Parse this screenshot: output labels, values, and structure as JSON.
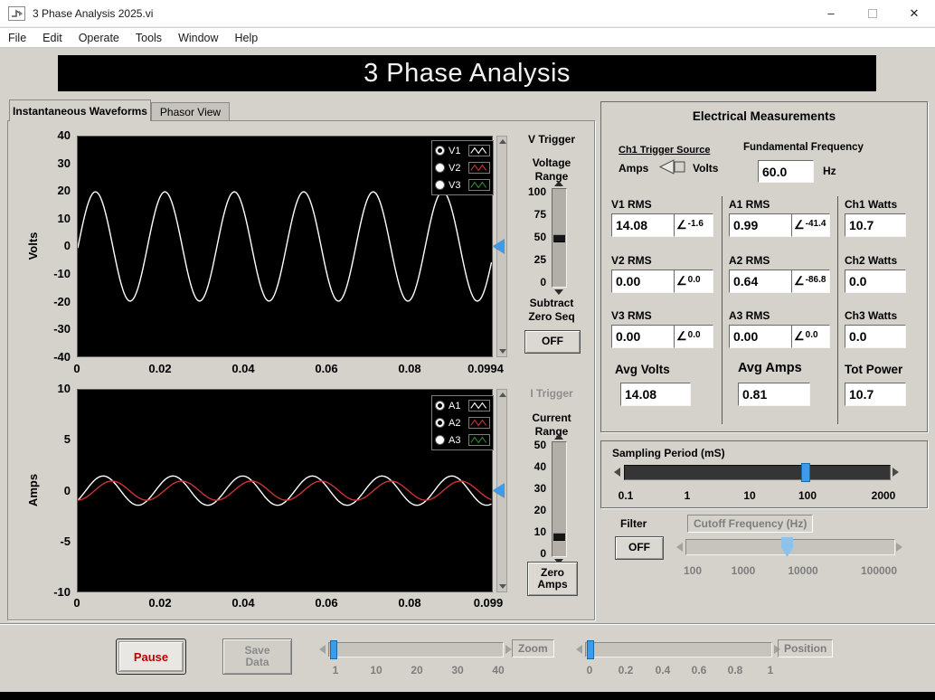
{
  "window": {
    "title": "3 Phase Analysis 2025.vi",
    "minimize": "–",
    "close": "✕"
  },
  "menu": {
    "items": [
      "File",
      "Edit",
      "Operate",
      "Tools",
      "Window",
      "Help"
    ]
  },
  "banner": {
    "title": "3 Phase Analysis"
  },
  "tabs": {
    "instantaneous": "Instantaneous Waveforms",
    "phasor": "Phasor View"
  },
  "volts_graph": {
    "ylabel": "Volts",
    "yticks": [
      "40",
      "30",
      "20",
      "10",
      "0",
      "-10",
      "-20",
      "-30",
      "-40"
    ],
    "xticks": [
      "0",
      "0.02",
      "0.04",
      "0.06",
      "0.08",
      "0.0994"
    ],
    "legend": [
      {
        "label": "V1",
        "selected": true,
        "color": "#ffffff"
      },
      {
        "label": "V2",
        "selected": false,
        "color": "#c83434"
      },
      {
        "label": "V3",
        "selected": false,
        "color": "#2e8b2e"
      }
    ],
    "chart_data": {
      "type": "line",
      "x_range": [
        0,
        0.0994
      ],
      "y_range": [
        -40,
        40
      ],
      "series": [
        {
          "name": "V1",
          "color": "#ffffff",
          "amplitude": 19.9,
          "frequency_hz": 60,
          "phase_deg": -1.6
        }
      ]
    }
  },
  "v_trigger": {
    "title": "V Trigger",
    "range_label_1": "Voltage",
    "range_label_2": "Range",
    "ticks": [
      "100",
      "75",
      "50",
      "25",
      "0"
    ],
    "value": 50,
    "subtract_label_1": "Subtract",
    "subtract_label_2": "Zero Seq",
    "subtract_button": "OFF"
  },
  "amps_graph": {
    "ylabel": "Amps",
    "yticks": [
      "10",
      "5",
      "0",
      "-5",
      "-10"
    ],
    "xticks": [
      "0",
      "0.02",
      "0.04",
      "0.06",
      "0.08",
      "0.099"
    ],
    "legend": [
      {
        "label": "A1",
        "selected": true,
        "color": "#ffffff"
      },
      {
        "label": "A2",
        "selected": true,
        "color": "#c83434"
      },
      {
        "label": "A3",
        "selected": false,
        "color": "#2e8b2e"
      }
    ],
    "chart_data": {
      "type": "line",
      "x_range": [
        0,
        0.099
      ],
      "y_range": [
        -10,
        10
      ],
      "series": [
        {
          "name": "A1",
          "color": "#ffffff",
          "amplitude": 1.45,
          "frequency_hz": 60,
          "phase_deg": -41.4
        },
        {
          "name": "A2",
          "color": "#c83434",
          "amplitude": 0.95,
          "frequency_hz": 60,
          "phase_deg": -86.8
        }
      ]
    }
  },
  "i_trigger": {
    "title": "I Trigger",
    "range_label_1": "Current",
    "range_label_2": "Range",
    "ticks": [
      "50",
      "40",
      "30",
      "20",
      "10",
      "0"
    ],
    "zero_button_1": "Zero",
    "zero_button_2": "Amps"
  },
  "measurements": {
    "title": "Electrical Measurements",
    "trigger_source": {
      "label": "Ch1 Trigger Source",
      "left": "Amps",
      "right": "Volts"
    },
    "fundamental": {
      "label": "Fundamental Frequency",
      "value": "60.0",
      "unit": "Hz"
    },
    "angle_symbol": "∠",
    "v1": {
      "label": "V1 RMS",
      "value": "14.08",
      "angle": "-1.6"
    },
    "v2": {
      "label": "V2 RMS",
      "value": "0.00",
      "angle": "0.0"
    },
    "v3": {
      "label": "V3 RMS",
      "value": "0.00",
      "angle": "0.0"
    },
    "a1": {
      "label": "A1 RMS",
      "value": "0.99",
      "angle": "-41.4"
    },
    "a2": {
      "label": "A2 RMS",
      "value": "0.64",
      "angle": "-86.8"
    },
    "a3": {
      "label": "A3 RMS",
      "value": "0.00",
      "angle": "0.0"
    },
    "w1": {
      "label": "Ch1 Watts",
      "value": "10.7"
    },
    "w2": {
      "label": "Ch2 Watts",
      "value": "0.0"
    },
    "w3": {
      "label": "Ch3 Watts",
      "value": "0.0"
    },
    "avg_volts": {
      "label": "Avg Volts",
      "value": "14.08"
    },
    "avg_amps": {
      "label": "Avg Amps",
      "value": "0.81"
    },
    "tot_power": {
      "label": "Tot Power",
      "value": "10.7"
    }
  },
  "sampling": {
    "label": "Sampling Period (mS)",
    "value": "100",
    "ticks": [
      "0.1",
      "1",
      "10",
      "100",
      "2000"
    ]
  },
  "filter": {
    "label": "Filter",
    "button": "OFF",
    "cutoff_label": "Cutoff Frequency (Hz)",
    "cutoff_ticks": [
      "100",
      "1000",
      "10000",
      "100000"
    ]
  },
  "footer": {
    "pause": "Pause",
    "save_1": "Save",
    "save_2": "Data",
    "zoom_label": "Zoom",
    "zoom_ticks": [
      "1",
      "10",
      "20",
      "30",
      "40"
    ],
    "position_label": "Position",
    "position_ticks": [
      "0",
      "0.2",
      "0.4",
      "0.6",
      "0.8",
      "1"
    ]
  },
  "colors": {
    "accent_blue": "#3d9be9",
    "pause_red": "#c00000",
    "wave_red": "#c83434",
    "wave_green": "#2e8b2e"
  }
}
